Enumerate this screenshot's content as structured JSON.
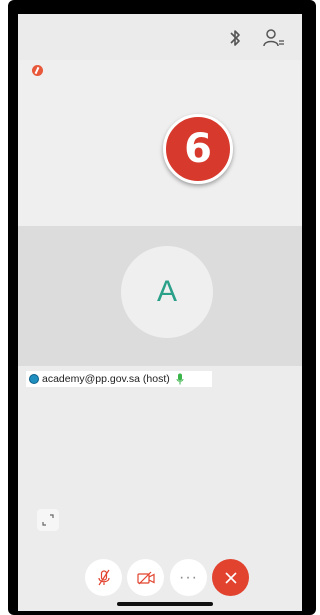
{
  "topbar": {
    "bluetooth_icon": "bluetooth-icon",
    "participants_icon": "participants-icon"
  },
  "stage": {
    "recording_indicator": "recording-icon",
    "step_badge": "6"
  },
  "tile": {
    "avatar_initial": "A",
    "participant_label": "academy@pp.gov.sa (host)"
  },
  "controls": {
    "mute": "muted-mic-icon",
    "video": "video-off-icon",
    "more": "···",
    "end": "close-icon"
  },
  "colors": {
    "accent_teal": "#2aa089",
    "end_red": "#e2432f",
    "badge_red": "#d8392d",
    "mic_green": "#3bb54a"
  }
}
